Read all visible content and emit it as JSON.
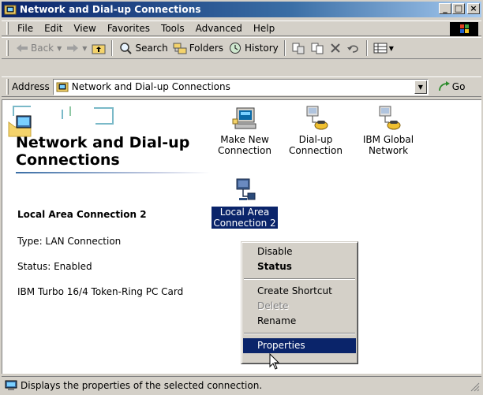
{
  "window": {
    "title": "Network and Dial-up Connections",
    "minimize": "_",
    "maximize": "□",
    "close": "×"
  },
  "menubar": {
    "items": [
      "File",
      "Edit",
      "View",
      "Favorites",
      "Tools",
      "Advanced",
      "Help"
    ]
  },
  "toolbar": {
    "back": "Back",
    "search": "Search",
    "folders": "Folders",
    "history": "History"
  },
  "address": {
    "label": "Address",
    "value": "Network and Dial-up Connections",
    "go": "Go"
  },
  "info_panel": {
    "title": "Network and Dial-up Connections",
    "selected_name": "Local Area Connection 2",
    "type": "Type: LAN Connection",
    "status": "Status: Enabled",
    "device": "IBM Turbo 16/4 Token-Ring PC Card"
  },
  "connections": [
    {
      "label_line1": "Make New",
      "label_line2": "Connection",
      "icon": "make-new-connection-icon"
    },
    {
      "label_line1": "Dial-up",
      "label_line2": "Connection",
      "icon": "dial-up-connection-icon"
    },
    {
      "label_line1": "IBM Global",
      "label_line2": "Network",
      "icon": "dial-up-connection-icon"
    },
    {
      "label_line1": "Local Area",
      "label_line2": "Connection 2",
      "icon": "lan-connection-icon",
      "selected": true
    }
  ],
  "context_menu": {
    "items": [
      {
        "label": "Disable"
      },
      {
        "label": "Status",
        "bold": true
      },
      {
        "label": "Create Shortcut"
      },
      {
        "label": "Delete",
        "disabled": true
      },
      {
        "label": "Rename"
      },
      {
        "label": "Properties",
        "highlighted": true
      }
    ]
  },
  "statusbar": {
    "text": "Displays the properties of the selected connection."
  },
  "colors": {
    "title_active": "#0a246a",
    "selection": "#0a246a",
    "chrome": "#d4d0c8"
  }
}
